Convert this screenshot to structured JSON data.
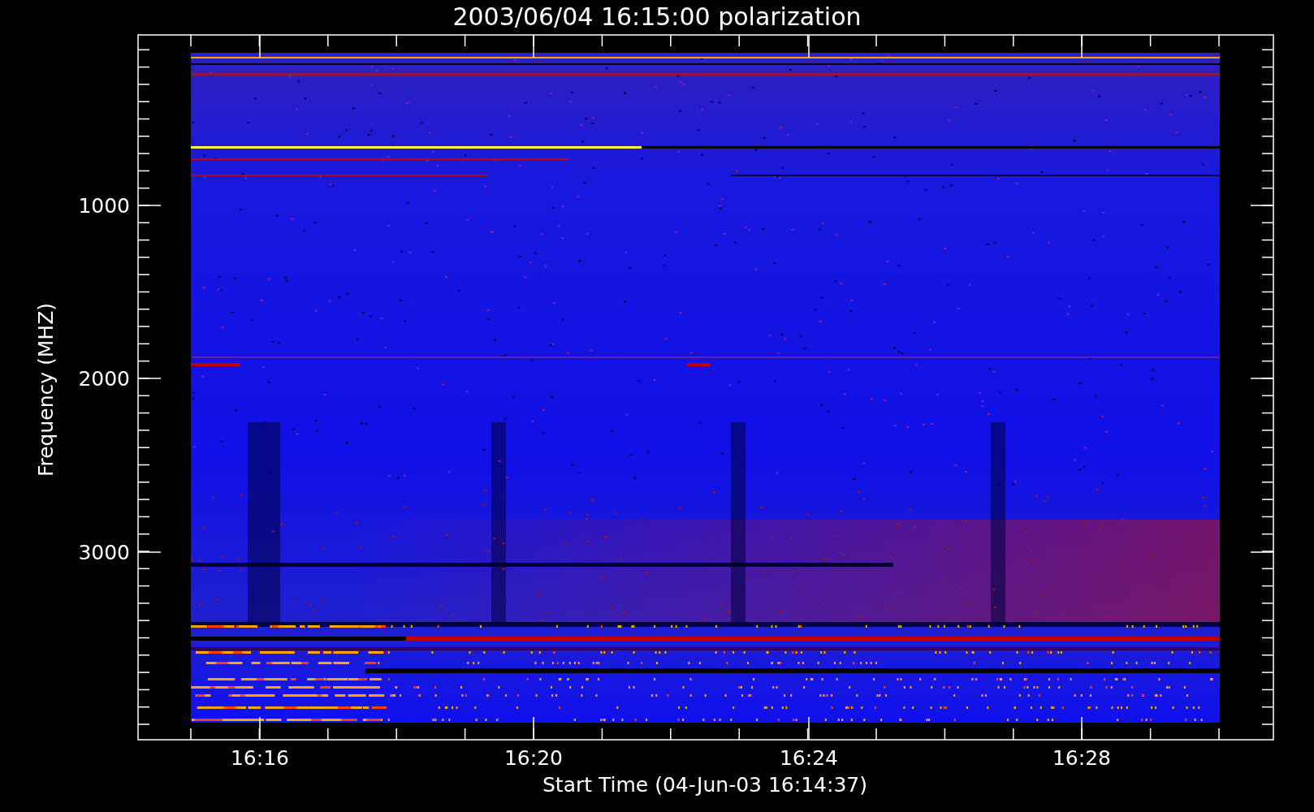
{
  "plot": {
    "title": "2003/06/04 16:15:00 polarization",
    "xlabel": "Start Time (04-Jun-03 16:14:37)",
    "ylabel": "Frequency (MHZ)",
    "x_tick_labels": [
      "16:16",
      "16:20",
      "16:24",
      "16:28"
    ],
    "y_tick_labels": [
      "1000",
      "2000",
      "3000"
    ]
  }
}
